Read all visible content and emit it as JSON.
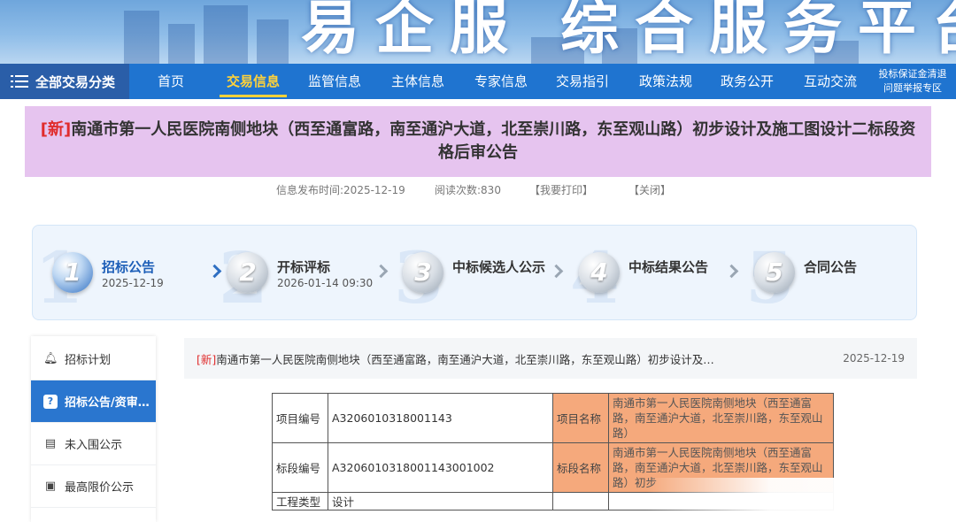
{
  "banner": {
    "slogan": "易企服  综合服务平台"
  },
  "nav": {
    "category_label": "全部交易分类",
    "items": [
      "首页",
      "交易信息",
      "监管信息",
      "主体信息",
      "专家信息",
      "交易指引",
      "政策法规",
      "政务公开",
      "互动交流"
    ],
    "active_index": 1,
    "special_line1": "投标保证金清退",
    "special_line2": "问题举报专区"
  },
  "notice": {
    "new_tag": "[新]",
    "title": "南通市第一人民医院南侧地块（西至通富路，南至通沪大道，北至崇川路，东至观山路）初步设计及施工图设计二标段资格后审公告",
    "publish_time": "信息发布时间:2025-12-19",
    "read_count": "阅读次数:830",
    "print_label": "【我要打印】",
    "close_label": "【关闭】"
  },
  "process": {
    "steps": [
      {
        "num": "1",
        "name": "招标公告",
        "date": "2025-12-19",
        "status": "done"
      },
      {
        "num": "2",
        "name": "开标评标",
        "date": "2026-01-14 09:30",
        "status": "pending"
      },
      {
        "num": "3",
        "name": "中标候选人公示",
        "date": "",
        "status": "pending"
      },
      {
        "num": "4",
        "name": "中标结果公告",
        "date": "",
        "status": "pending"
      },
      {
        "num": "5",
        "name": "合同公告",
        "date": "",
        "status": "pending"
      }
    ]
  },
  "sidebar": {
    "items": [
      {
        "label": "招标计划",
        "icon": "bell-icon"
      },
      {
        "label": "招标公告/资审…",
        "icon": "notice-icon"
      },
      {
        "label": "未入围公示",
        "icon": "briefcase-icon"
      },
      {
        "label": "最高限价公示",
        "icon": "price-check-icon"
      }
    ],
    "active_index": 1
  },
  "content": {
    "new_tag": "[新]",
    "headline": "南通市第一人民医院南侧地块（西至通富路，南至通沪大道，北至崇川路，东至观山路）初步设计及…",
    "date": "2025-12-19"
  },
  "table": {
    "rows": [
      {
        "label": "项目编号",
        "value": "A3206010318001143",
        "label2": "项目名称",
        "value2": "南通市第一人民医院南侧地块（西至通富路，南至通沪大道，北至崇川路，东至观山路）"
      },
      {
        "label": "标段编号",
        "value": "A3206010318001143001002",
        "label2": "标段名称",
        "value2": "南通市第一人民医院南侧地块（西至通富路，南至通沪大道，北至崇川路，东至观山路）初步"
      },
      {
        "label": "工程类型",
        "value": "设计",
        "label2": "",
        "value2": ""
      }
    ]
  }
}
